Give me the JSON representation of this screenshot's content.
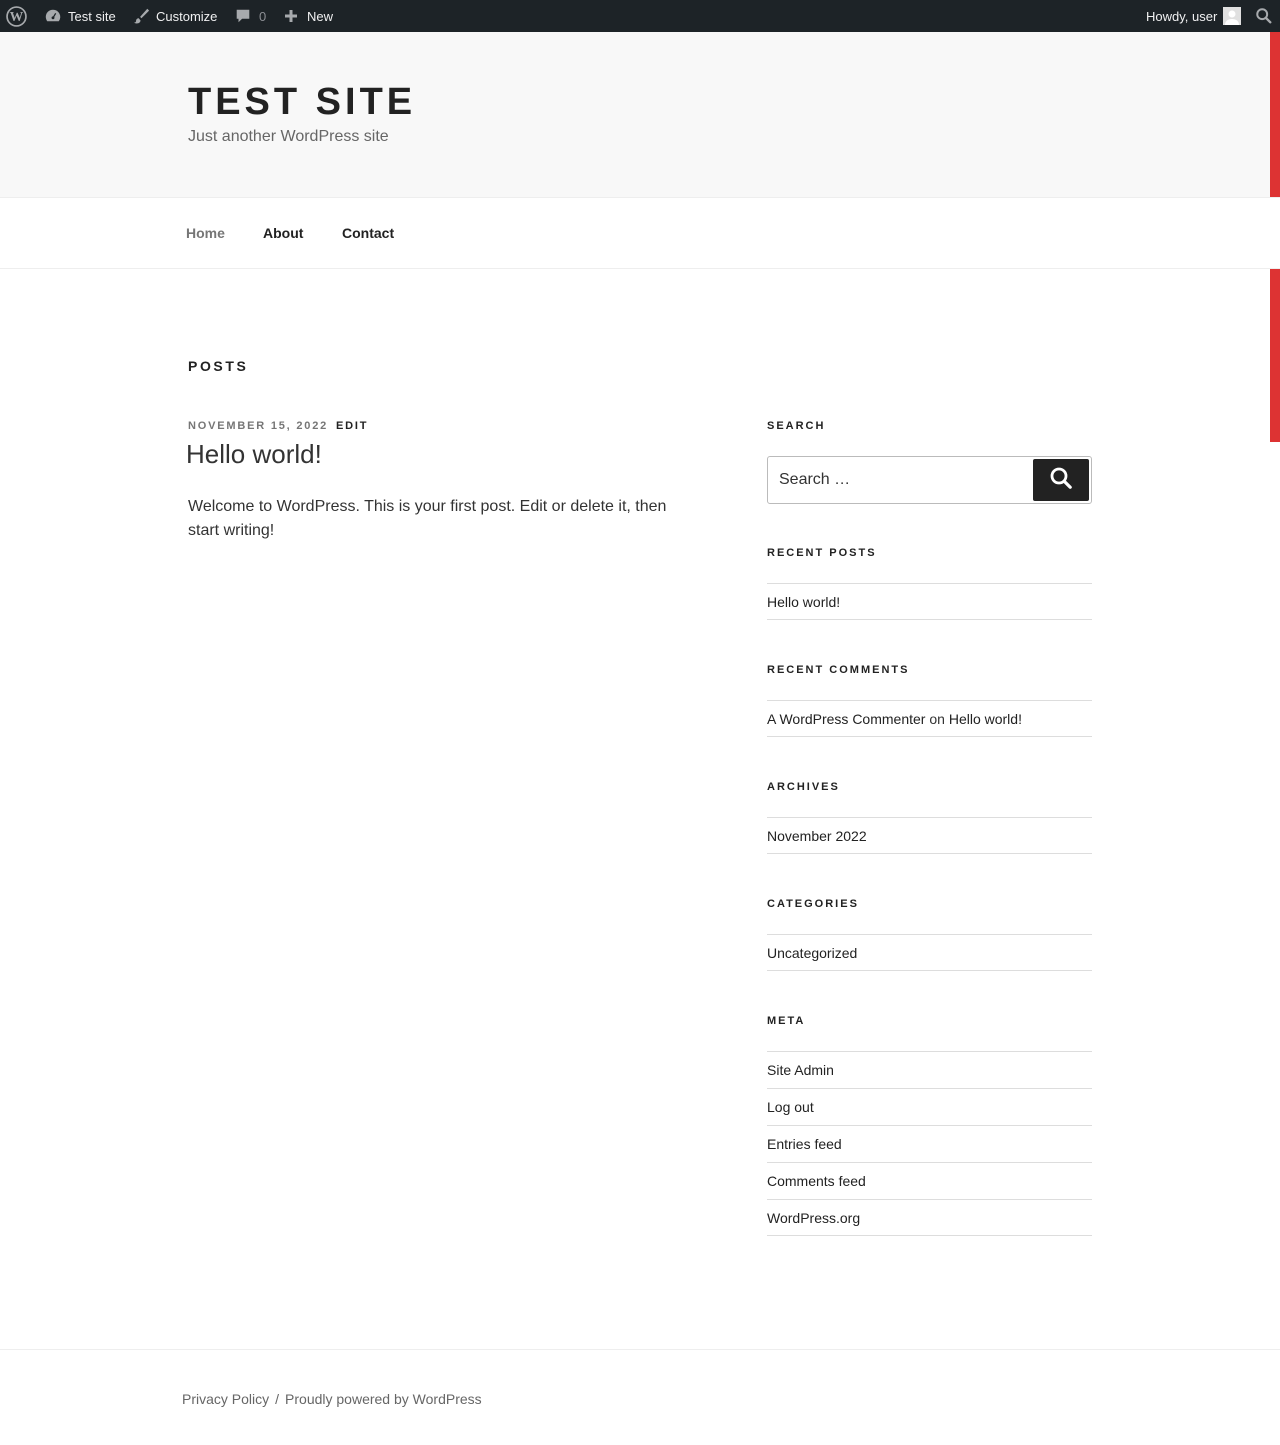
{
  "adminbar": {
    "site_name": "Test site",
    "customize": "Customize",
    "comments_count": "0",
    "new": "New",
    "howdy": "Howdy, user"
  },
  "header": {
    "title": "TEST SITE",
    "description": "Just another WordPress site"
  },
  "nav": {
    "items": [
      {
        "label": "Home"
      },
      {
        "label": "About"
      },
      {
        "label": "Contact"
      }
    ]
  },
  "main": {
    "page_title": "POSTS",
    "post": {
      "date": "NOVEMBER 15, 2022",
      "edit": "EDIT",
      "title": "Hello world!",
      "body": "Welcome to WordPress. This is your first post. Edit or delete it, then start writing!"
    }
  },
  "sidebar": {
    "search": {
      "title": "SEARCH",
      "placeholder": "Search …"
    },
    "recent_posts": {
      "title": "RECENT POSTS",
      "items": [
        "Hello world!"
      ]
    },
    "recent_comments": {
      "title": "RECENT COMMENTS",
      "author": "A WordPress Commenter",
      "on": "on",
      "post": "Hello world!"
    },
    "archives": {
      "title": "ARCHIVES",
      "items": [
        "November 2022"
      ]
    },
    "categories": {
      "title": "CATEGORIES",
      "items": [
        "Uncategorized"
      ]
    },
    "meta": {
      "title": "META",
      "items": [
        "Site Admin",
        "Log out",
        "Entries feed",
        "Comments feed",
        "WordPress.org"
      ]
    }
  },
  "footer": {
    "privacy": "Privacy Policy",
    "separator": "/",
    "powered": "Proudly powered by WordPress"
  },
  "colors": {
    "adminbar_bg": "#1d2327",
    "accent": "#dd3333",
    "header_bg": "#f8f8f8"
  },
  "icons": [
    "wordpress-logo-icon",
    "dashboard-icon",
    "brush-icon",
    "comment-icon",
    "plus-icon",
    "avatar",
    "search-icon"
  ]
}
